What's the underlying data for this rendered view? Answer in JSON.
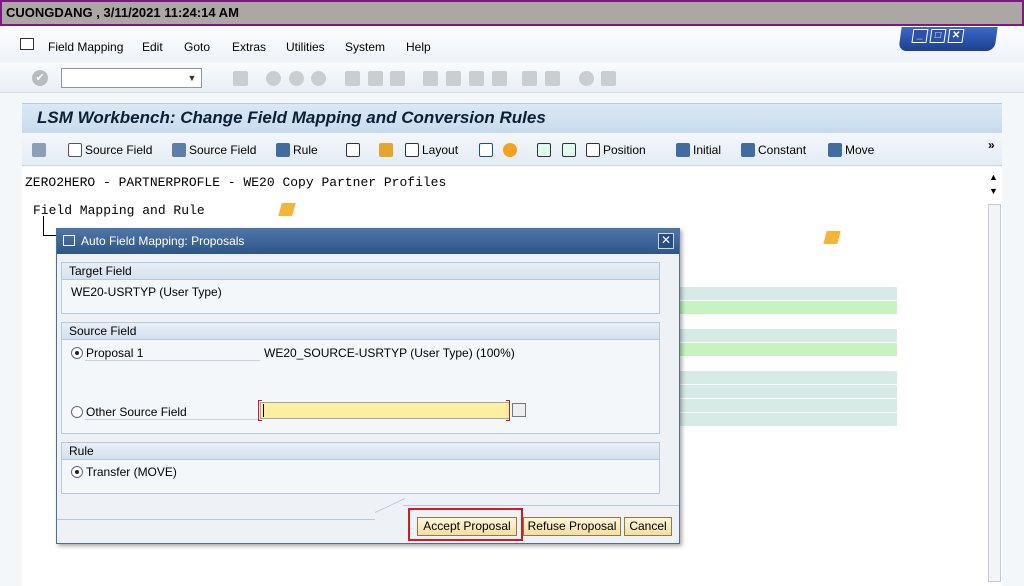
{
  "titlebar": {
    "text": "CUONGDANG  , 3/11/2021 11:24:14 AM"
  },
  "menu": {
    "items": [
      "Field Mapping",
      "Edit",
      "Goto",
      "Extras",
      "Utilities",
      "System",
      "Help"
    ]
  },
  "page": {
    "title": "LSM Workbench: Change Field Mapping and Conversion Rules"
  },
  "apptoolbar": {
    "buttons": [
      "Source Field",
      "Source Field",
      "Rule",
      "Layout",
      "Position",
      "Initial",
      "Constant",
      "Move"
    ]
  },
  "content": {
    "line1": "ZERO2HERO - PARTNERPROFLE - WE20 Copy Partner Profiles",
    "line2": "Field Mapping and Rule"
  },
  "dialog": {
    "title": "Auto Field Mapping: Proposals",
    "target_group": "Target Field",
    "target_value": "WE20-USRTYP (User Type)",
    "source_group": "Source Field",
    "proposal_label": "Proposal 1",
    "proposal_value": "WE20_SOURCE-USRTYP (User Type) (100%)",
    "other_label": "Other Source Field",
    "other_value": "",
    "rule_group": "Rule",
    "rule_value": "Transfer (MOVE)",
    "accept": "Accept Proposal",
    "refuse": "Refuse Proposal",
    "cancel": "Cancel"
  },
  "colors": {
    "titlebar_border": "#7b1a7e",
    "highlight": "#d21b20",
    "input_yellow": "#fdeea0",
    "grid_green": "#c6f3c0",
    "grid_teal": "#d6ebe6"
  }
}
